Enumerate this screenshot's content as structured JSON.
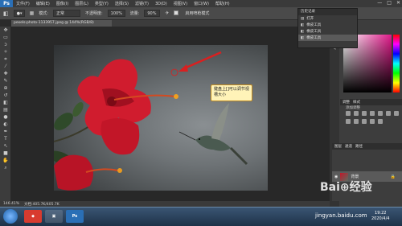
{
  "app": {
    "logo": "Ps"
  },
  "menubar": {
    "items": [
      "文件(F)",
      "编辑(E)",
      "图像(I)",
      "图层(L)",
      "类型(Y)",
      "选择(S)",
      "滤镜(T)",
      "3D(D)",
      "视图(V)",
      "窗口(W)",
      "帮助(H)"
    ]
  },
  "window_controls": {
    "minimize": "—",
    "maximize": "□",
    "close": "✕"
  },
  "options": {
    "mode_label": "模式:",
    "mode_value": "正常",
    "opacity_label": "不透明度:",
    "opacity_value": "100%",
    "flow_label": "流量:",
    "flow_value": "90%",
    "checkbox_label": "启用喷枪模式"
  },
  "document": {
    "tab_title": "pexels-photo-1133957.jpeg @ 144%(RGB/8)",
    "annotation": "键盘上[]可以调节视槽大小"
  },
  "status": {
    "zoom": "146.41%",
    "doc_size": "文档:405.7K/405.7K"
  },
  "history_panel": {
    "title": "历史记录",
    "rows": [
      "打开",
      "橡皮工具",
      "橡皮工具",
      "橡皮工具"
    ],
    "selected_index": 3
  },
  "adjust_panel": {
    "tabs": [
      "调整",
      "样式"
    ],
    "title": "添加调整"
  },
  "layers_panel": {
    "tabs": [
      "图层",
      "通道",
      "路径"
    ],
    "layer_name": "背景"
  },
  "toolbox": {
    "icons": [
      "move-icon",
      "marquee-icon",
      "lasso-icon",
      "magic-wand-icon",
      "crop-icon",
      "eyedropper-icon",
      "healing-icon",
      "brush-icon",
      "stamp-icon",
      "history-brush-icon",
      "eraser-icon",
      "gradient-icon",
      "blur-icon",
      "dodge-icon",
      "pen-icon",
      "type-icon",
      "path-select-icon",
      "shape-icon",
      "hand-icon",
      "zoom-icon"
    ],
    "glyphs": [
      "✥",
      "▭",
      "ↄ",
      "✧",
      "⌗",
      "⁄",
      "✚",
      "✎",
      "⊕",
      "↺",
      "◧",
      "▤",
      "●",
      "◐",
      "✒",
      "T",
      "↖",
      "■",
      "✋",
      "⌕"
    ]
  },
  "taskbar": {
    "app_label": "Ps",
    "clock_time": "19:22",
    "clock_date": "2020/4/4"
  },
  "watermark": {
    "text": "Bai⊕经验",
    "url": "jingyan.baidu.com"
  },
  "colors": {
    "accent": "#2a6fb6",
    "annotation_bg": "#fff3b8",
    "flower": "#c0182a",
    "arrow": "#d92020"
  }
}
